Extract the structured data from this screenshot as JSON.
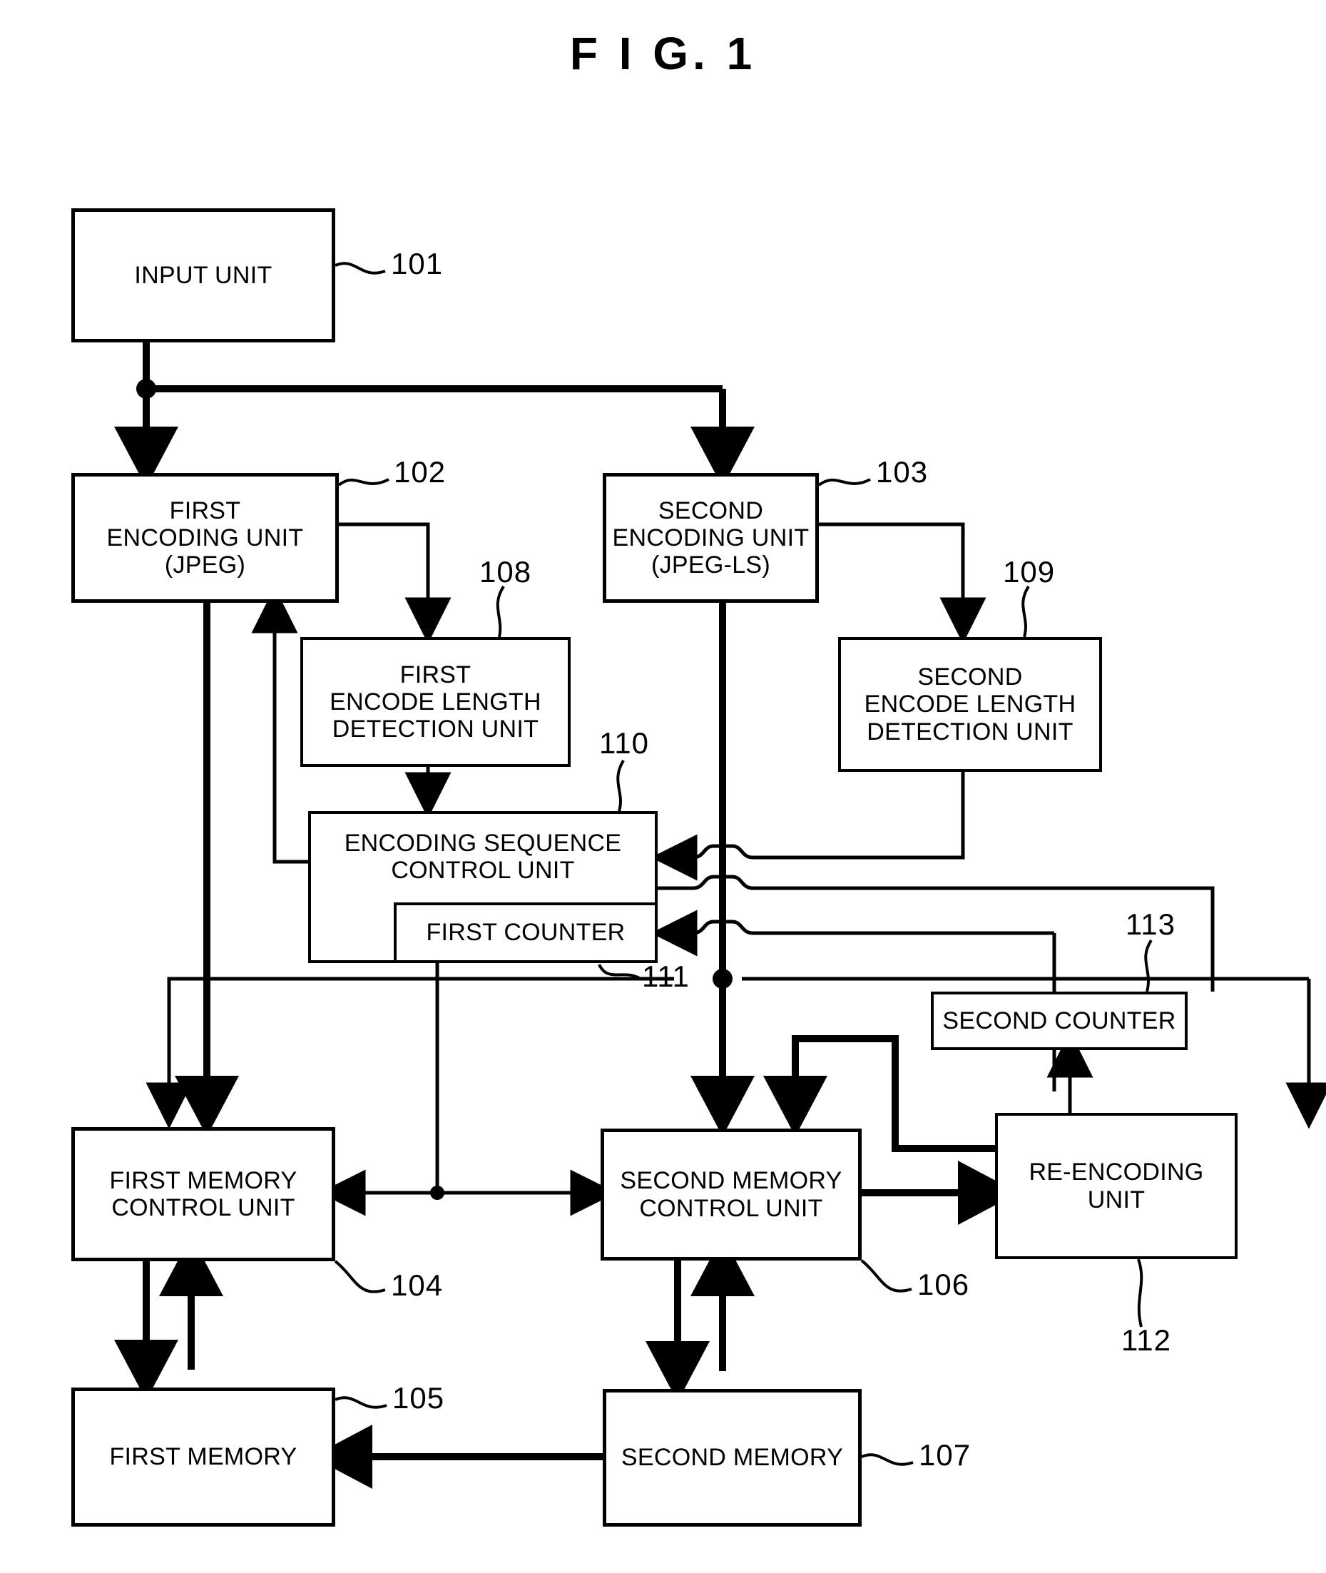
{
  "figure": {
    "title": "F I G. 1",
    "kind": "block-diagram"
  },
  "blocks": [
    {
      "id": "101",
      "label": "INPUT UNIT",
      "ref": "101"
    },
    {
      "id": "102",
      "label": "FIRST\nENCODING UNIT\n(JPEG)",
      "ref": "102"
    },
    {
      "id": "103",
      "label": "SECOND\nENCODING UNIT\n(JPEG-LS)",
      "ref": "103"
    },
    {
      "id": "108",
      "label": "FIRST\nENCODE LENGTH\nDETECTION UNIT",
      "ref": "108"
    },
    {
      "id": "109",
      "label": "SECOND\nENCODE LENGTH\nDETECTION UNIT",
      "ref": "109"
    },
    {
      "id": "110",
      "label": "ENCODING SEQUENCE\nCONTROL UNIT",
      "ref": "110"
    },
    {
      "id": "111",
      "label": "FIRST COUNTER",
      "ref": "111"
    },
    {
      "id": "113",
      "label": "SECOND COUNTER",
      "ref": "113"
    },
    {
      "id": "104",
      "label": "FIRST MEMORY\nCONTROL UNIT",
      "ref": "104"
    },
    {
      "id": "106",
      "label": "SECOND MEMORY\nCONTROL UNIT",
      "ref": "106"
    },
    {
      "id": "112",
      "label": "RE-ENCODING\nUNIT",
      "ref": "112"
    },
    {
      "id": "105",
      "label": "FIRST MEMORY",
      "ref": "105"
    },
    {
      "id": "107",
      "label": "SECOND MEMORY",
      "ref": "107"
    }
  ],
  "labels": {
    "input_unit": "INPUT UNIT",
    "first_encoding_unit_l1": "FIRST",
    "first_encoding_unit_l2": "ENCODING UNIT",
    "first_encoding_unit_l3": "(JPEG)",
    "second_encoding_unit_l1": "SECOND",
    "second_encoding_unit_l2": "ENCODING UNIT",
    "second_encoding_unit_l3": "(JPEG-LS)",
    "first_detect_l1": "FIRST",
    "first_detect_l2": "ENCODE LENGTH",
    "first_detect_l3": "DETECTION UNIT",
    "second_detect_l1": "SECOND",
    "second_detect_l2": "ENCODE LENGTH",
    "second_detect_l3": "DETECTION UNIT",
    "sequence_ctrl_l1": "ENCODING SEQUENCE",
    "sequence_ctrl_l2": "CONTROL UNIT",
    "first_counter": "FIRST COUNTER",
    "second_counter": "SECOND COUNTER",
    "first_mem_ctrl_l1": "FIRST MEMORY",
    "first_mem_ctrl_l2": "CONTROL UNIT",
    "second_mem_ctrl_l1": "SECOND MEMORY",
    "second_mem_ctrl_l2": "CONTROL UNIT",
    "reencoding_l1": "RE-ENCODING",
    "reencoding_l2": "UNIT",
    "first_memory": "FIRST MEMORY",
    "second_memory": "SECOND MEMORY"
  },
  "refs": {
    "r101": "101",
    "r102": "102",
    "r103": "103",
    "r104": "104",
    "r105": "105",
    "r106": "106",
    "r107": "107",
    "r108": "108",
    "r109": "109",
    "r110": "110",
    "r111": "111",
    "r112": "112",
    "r113": "113"
  },
  "colors": {
    "ink": "#000000",
    "paper": "#ffffff"
  }
}
